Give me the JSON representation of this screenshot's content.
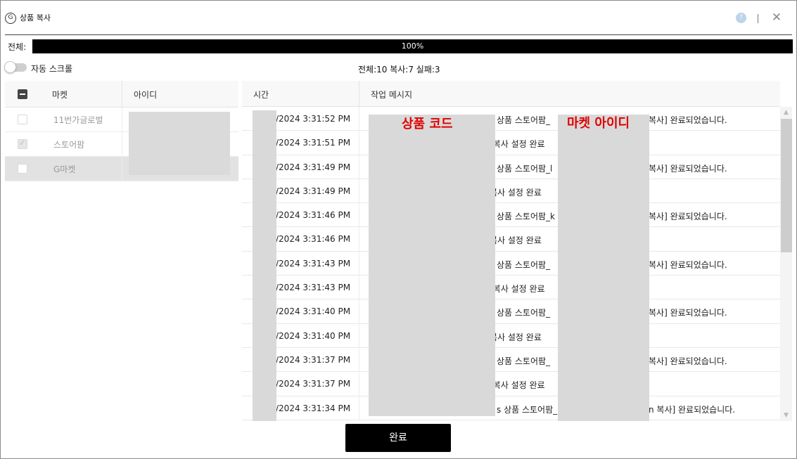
{
  "window": {
    "title": "상품 복사",
    "logo_icon": "app-logo-icon",
    "badge_icon": "help-badge-icon",
    "close_icon": "close-icon",
    "close_glyph": "✕"
  },
  "progress": {
    "label": "전체:",
    "percent_text": "100%",
    "value": 1.0
  },
  "auto_scroll": {
    "label": "자동 스크롤",
    "enabled": false
  },
  "summary": "전체:10 복사:7 실패:3",
  "market_table": {
    "headers": {
      "market": "마켓",
      "id": "아이디"
    },
    "rows": [
      {
        "name": "11번가글로벌",
        "checked": false,
        "selected": false
      },
      {
        "name": "스토어팜",
        "checked": true,
        "selected": false
      },
      {
        "name": "G마켓",
        "checked": false,
        "selected": true
      }
    ]
  },
  "log_table": {
    "headers": {
      "time": "시간",
      "message": "작업 메시지"
    },
    "rows": [
      {
        "time": "/2024 3:31:52 PM",
        "msg_a": "상품 스토어팜_",
        "msg_b": "복사] 완료되었습니다."
      },
      {
        "time": "/2024 3:31:51 PM",
        "msg_c": "]복사 설정 완료"
      },
      {
        "time": "/2024 3:31:49 PM",
        "msg_a": "상품 스토어팜_l",
        "msg_b": "복사] 완료되었습니다."
      },
      {
        "time": "/2024 3:31:49 PM",
        "msg_c": "복사 설정 완료"
      },
      {
        "time": "/2024 3:31:46 PM",
        "msg_a": "상품 스토어팜_k",
        "msg_b": "복사] 완료되었습니다."
      },
      {
        "time": "/2024 3:31:46 PM",
        "msg_c": "복사 설정 완료"
      },
      {
        "time": "/2024 3:31:43 PM",
        "msg_a": "상품 스토어팜_",
        "msg_b": "복사] 완료되었습니다."
      },
      {
        "time": "/2024 3:31:43 PM",
        "msg_c": "]복사 설정 완료"
      },
      {
        "time": "/2024 3:31:40 PM",
        "msg_a": "상품 스토어팜_",
        "msg_b": "복사] 완료되었습니다."
      },
      {
        "time": "/2024 3:31:40 PM",
        "msg_c": "복사 설정 완료"
      },
      {
        "time": "/2024 3:31:37 PM",
        "msg_a": "상품 스토어팜_",
        "msg_b": "복사] 완료되었습니다."
      },
      {
        "time": "/2024 3:31:37 PM",
        "msg_c": "]복사 설정 완료"
      },
      {
        "time": "/2024 3:31:34 PM",
        "msg_a": "s 상품 스토어팜_",
        "msg_b": "n 복사] 완료되었습니다."
      }
    ],
    "redaction_labels": {
      "code": "상품 코드",
      "id": "마켓 아이디"
    }
  },
  "scrollbar": {
    "up_glyph": "▲",
    "down_glyph": "▼"
  },
  "done_button": "완료"
}
